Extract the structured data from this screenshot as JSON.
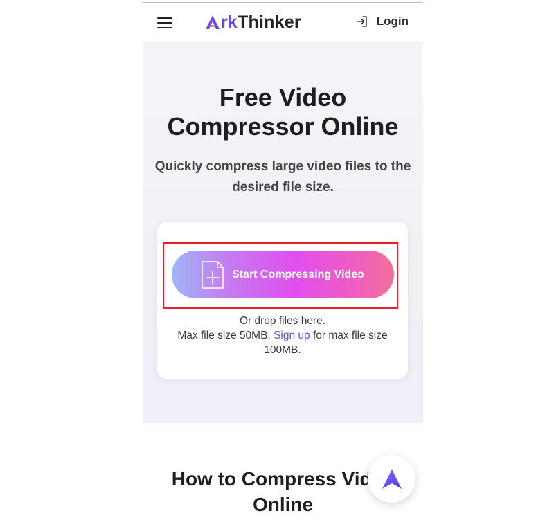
{
  "header": {
    "logo": {
      "first_letter": "A",
      "accent_part": "rk",
      "rest": "Thinker"
    },
    "login_label": "Login"
  },
  "hero": {
    "title": "Free Video Compressor Online",
    "subtitle": "Quickly compress large video files to the desired file size."
  },
  "upload": {
    "button_label": "Start Compressing Video",
    "drop_hint": "Or drop files here.",
    "limit_prefix": "Max file size 50MB.",
    "signup_link": "Sign up",
    "limit_suffix": "for max file size 100MB."
  },
  "section": {
    "heading": "How to Compress Video Online"
  },
  "icons": {
    "menu": "hamburger-menu-icon",
    "login": "login-icon",
    "file_add": "file-plus-icon",
    "scroll_top": "arrow-up-icon"
  },
  "colors": {
    "brand_purple": "#6e43e8",
    "button_gradient": [
      "#9fb5f7",
      "#e04ff0",
      "#f27099"
    ],
    "highlight_border": "#e8202a",
    "link": "#6a4ee0"
  }
}
